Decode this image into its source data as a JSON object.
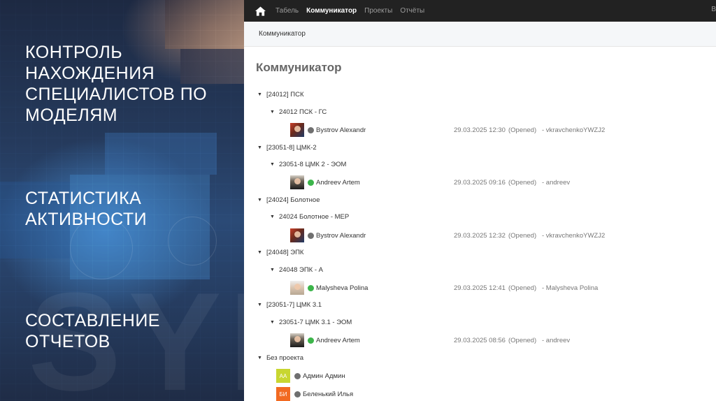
{
  "promo": {
    "block1": [
      "КОНТРОЛЬ",
      "НАХОЖДЕНИЯ",
      "СПЕЦИАЛИСТОВ ПО",
      "МОДЕЛЯМ"
    ],
    "block2": [
      "СТАТИСТИКА",
      "АКТИВНОСТИ"
    ],
    "block3": [
      "СОСТАВЛЕНИЕ",
      "ОТЧЕТОВ"
    ],
    "watermark": "SYN"
  },
  "nav": {
    "home_icon": "home-icon",
    "links": [
      "Табель",
      "Коммуникатор",
      "Проекты",
      "Отчёты"
    ],
    "active": "Коммуникатор",
    "right_text": "В"
  },
  "breadcrumb": "Коммуникатор",
  "title": "Коммуникатор",
  "colors": {
    "online": "#3cb54a",
    "offline": "#6f6f6f",
    "navbar": "#222222"
  },
  "groups": [
    {
      "label": "[24012] ПСК",
      "sub": "24012 ПСК - ГС",
      "user": {
        "name": "Bystrov Alexandr",
        "status": "offline",
        "date": "29.03.2025 12:30",
        "state": "(Opened)",
        "by": "- vkravchenkoYWZJ2"
      }
    },
    {
      "label": "[23051-8] ЦМК-2",
      "sub": "23051-8 ЦМК 2 - ЭОМ",
      "user": {
        "name": "Andreev Artem",
        "status": "online",
        "date": "29.03.2025 09:16",
        "state": "(Opened)",
        "by": "- andreev"
      }
    },
    {
      "label": "[24024] Болотное",
      "sub": "24024 Болотное - МЕР",
      "user": {
        "name": "Bystrov Alexandr",
        "status": "offline",
        "date": "29.03.2025 12:32",
        "state": "(Opened)",
        "by": "- vkravchenkoYWZJ2"
      }
    },
    {
      "label": "[24048] ЭПК",
      "sub": "24048 ЭПК - А",
      "user": {
        "name": "Malysheva Polina",
        "status": "online",
        "date": "29.03.2025 12:41",
        "state": "(Opened)",
        "by": "- Malysheva Polina"
      }
    },
    {
      "label": "[23051-7] ЦМК 3.1",
      "sub": "23051-7 ЦМК 3.1 - ЭОМ",
      "user": {
        "name": "Andreev Artem",
        "status": "online",
        "date": "29.03.2025 08:56",
        "state": "(Opened)",
        "by": "- andreev"
      }
    }
  ],
  "no_project": {
    "label": "Без проекта",
    "users": [
      {
        "initials": "АА",
        "name": "Админ Админ",
        "status": "offline"
      },
      {
        "initials": "БИ",
        "name": "Беленький Илья",
        "status": "offline"
      }
    ]
  }
}
